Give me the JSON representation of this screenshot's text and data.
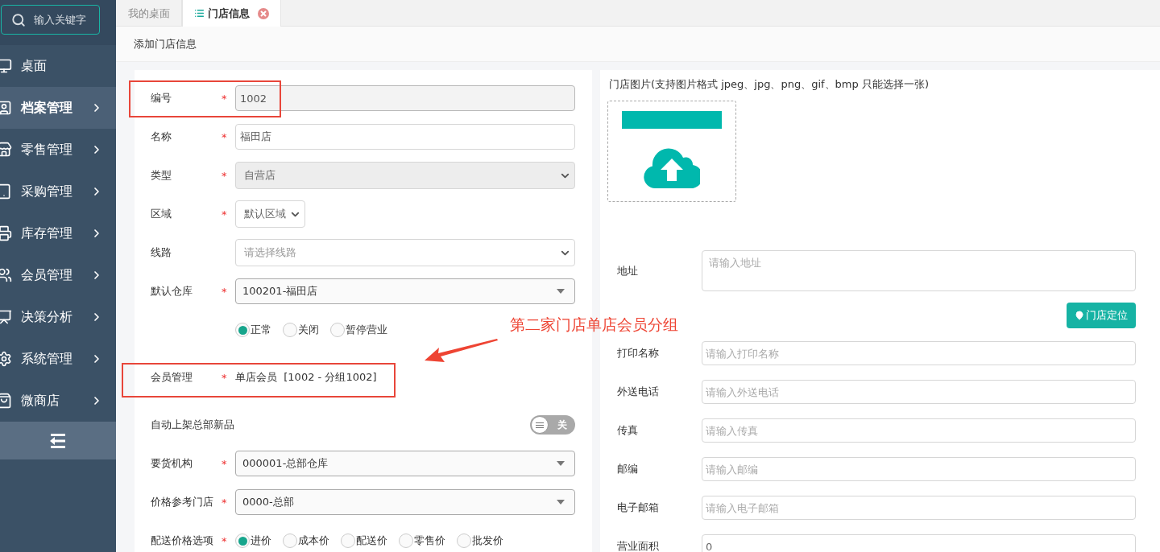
{
  "search": {
    "placeholder": "输入关键字"
  },
  "sidebar": {
    "items": [
      {
        "label": "桌面",
        "selected": false,
        "expandable": false
      },
      {
        "label": "档案管理",
        "selected": true,
        "expandable": true
      },
      {
        "label": "零售管理",
        "selected": false,
        "expandable": true
      },
      {
        "label": "采购管理",
        "selected": false,
        "expandable": true
      },
      {
        "label": "库存管理",
        "selected": false,
        "expandable": true
      },
      {
        "label": "会员管理",
        "selected": false,
        "expandable": true
      },
      {
        "label": "决策分析",
        "selected": false,
        "expandable": true
      },
      {
        "label": "系统管理",
        "selected": false,
        "expandable": true
      },
      {
        "label": "微商店",
        "selected": false,
        "expandable": true
      }
    ]
  },
  "tabs": [
    {
      "label": "我的桌面",
      "selected": false,
      "closable": false
    },
    {
      "label": "门店信息",
      "selected": true,
      "closable": true
    }
  ],
  "page_title": "添加门店信息",
  "left_form": [
    {
      "kind": "input",
      "label": "编号",
      "required_mark": "*",
      "value": "1002",
      "disabled": true,
      "highlighted": true
    },
    {
      "kind": "input",
      "label": "名称",
      "required_mark": "*",
      "value": "福田店",
      "disabled": false
    },
    {
      "kind": "select",
      "label": "类型",
      "required_mark": "*",
      "value": "自营店",
      "disabled": true
    },
    {
      "kind": "short_select",
      "label": "区域",
      "required_mark": "*",
      "value": "默认区域",
      "disabled": false
    },
    {
      "kind": "select",
      "label": "线路",
      "placeholder": "请选择线路",
      "disabled": false
    },
    {
      "kind": "combo",
      "label": "默认仓库",
      "required_mark": "*",
      "value": "100201-福田店"
    },
    {
      "kind": "radios",
      "options": [
        {
          "label": "正常",
          "selected": true
        },
        {
          "label": "关闭",
          "selected": false
        },
        {
          "label": "暂停营业",
          "selected": false
        }
      ]
    },
    {
      "kind": "static",
      "label": "会员管理",
      "required_mark": "*",
      "value": "单店会员  [1002 - 分组1002]",
      "highlighted": true
    },
    {
      "kind": "toggle",
      "label": "自动上架总部新品",
      "on": false,
      "state_text": "关"
    },
    {
      "kind": "combo",
      "label": "要货机构",
      "required_mark": "*",
      "value": "000001-总部仓库"
    },
    {
      "kind": "combo",
      "label": "价格参考门店",
      "required_mark": "*",
      "value": "0000-总部"
    },
    {
      "kind": "radios",
      "label": "配送价格选项",
      "required_mark": "*",
      "options": [
        {
          "label": "进价",
          "selected": true
        },
        {
          "label": "成本价",
          "selected": false
        },
        {
          "label": "配送价",
          "selected": false
        },
        {
          "label": "零售价",
          "selected": false
        },
        {
          "label": "批发价",
          "selected": false
        }
      ]
    }
  ],
  "annotation": {
    "text": "第二家门店单店会员分组"
  },
  "right_form": {
    "image_label": "门店图片(支持图片格式 jpeg、jpg、png、gif、bmp 只能选择一张)",
    "address": {
      "label": "地址",
      "placeholder": "请输入地址"
    },
    "locate_button": "门店定位",
    "fields": [
      {
        "label": "打印名称",
        "placeholder": "请输入打印名称"
      },
      {
        "label": "外送电话",
        "placeholder": "请输入外送电话"
      },
      {
        "label": "传真",
        "placeholder": "请输入传真"
      },
      {
        "label": "邮编",
        "placeholder": "请输入邮编"
      },
      {
        "label": "电子邮箱",
        "placeholder": "请输入电子邮箱"
      },
      {
        "label": "营业面积",
        "value": "0"
      }
    ]
  }
}
